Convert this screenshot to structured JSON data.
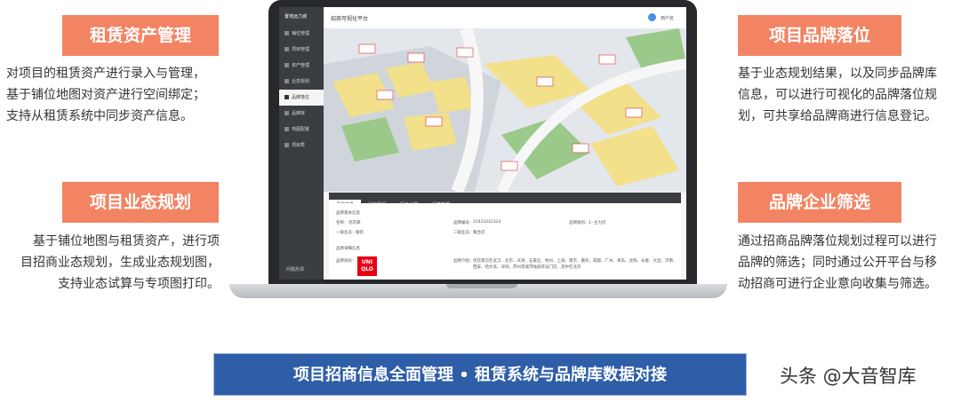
{
  "features": {
    "left_top": {
      "title": "租赁资产管理",
      "lines": [
        "对项目的租赁资产进行录入与管理，",
        "基于铺位地图对资产进行空间绑定；",
        "支持从租赁系统中同步资产信息。"
      ]
    },
    "left_bottom": {
      "title": "项目业态规划",
      "lines": [
        "基于铺位地图与租赁资产，进行项",
        "目招商业态规划，生成业态规划图，",
        "支持业态试算与专项图打印。"
      ]
    },
    "right_top": {
      "title": "项目品牌落位",
      "lines": [
        "基于业态规划结果，以及同步品牌库",
        "信息，可以进行可视化的品牌落位规",
        "划，可共享给品牌商进行信息登记。"
      ]
    },
    "right_bottom": {
      "title": "品牌企业筛选",
      "lines": [
        "通过招商品牌落位规划过程可以进行",
        "品牌的筛选；同时通过公开平台与移",
        "动招商可进行企业意向收集与筛选。"
      ]
    }
  },
  "app": {
    "sidebar_title": "置地远力城",
    "sidebar_items": [
      {
        "label": "铺位管理",
        "active": false
      },
      {
        "label": "项目管理",
        "active": false
      },
      {
        "label": "资产管理",
        "active": false
      },
      {
        "label": "业态规划",
        "active": false
      },
      {
        "label": "品牌落位",
        "active": true
      },
      {
        "label": "品牌库",
        "active": false
      },
      {
        "label": "地图配置",
        "active": false
      },
      {
        "label": "项目秀",
        "active": false
      }
    ],
    "sidebar_footer": "问题反馈",
    "header_title": "招商可视化平台",
    "user_label": "用户名",
    "tabs": [
      {
        "label": "品牌信息",
        "active": true
      },
      {
        "label": "门店情况",
        "active": false
      },
      {
        "label": "历史合同",
        "active": false
      },
      {
        "label": "经营数据",
        "active": false
      }
    ],
    "detail": {
      "section1": "品牌基本信息",
      "name_label": "名称：",
      "name_value": "优衣库",
      "code_label": "品牌编号：",
      "code_value": "12423242324",
      "level_label": "品牌级别：",
      "level_value": "1--主力店",
      "cat1_label": "一级业态：",
      "cat1_value": "服装",
      "cat2_label": "二级业态：",
      "cat2_value": "集合店",
      "section2": "品牌详细信息",
      "logo_label": "品牌商标：",
      "logo_text": "UNI QLO",
      "intro_label": "品牌介绍：",
      "intro_value": "优衣库已在武汉、北京、天津、石家庄、杭州、上海、南京、重庆、成都、广州、青岛、沈阳、长春、大连、济南、西安、哈尔滨、深圳、苏州等城市陆续开设门店，其中在北京"
    }
  },
  "banner": "项目招商信息全面管理 • 租赁系统与品牌库数据对接",
  "watermark": "头条 @大音智库"
}
